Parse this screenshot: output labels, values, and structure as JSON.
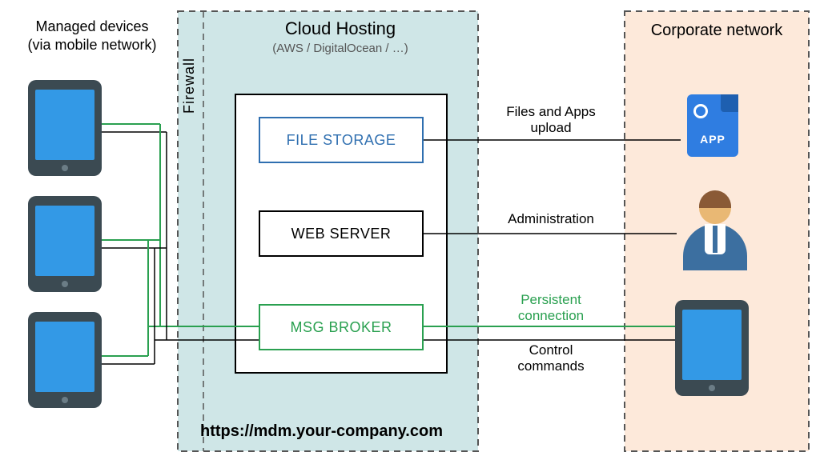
{
  "managed_devices": {
    "title": "Managed devices\n(via mobile network)"
  },
  "firewall_label": "Firewall",
  "cloud_hosting": {
    "title": "Cloud Hosting",
    "subtitle": "(AWS / DigitalOcean / …)",
    "services": {
      "storage": "FILE STORAGE",
      "web": "WEB SERVER",
      "broker": "MSG BROKER"
    },
    "url": "https://mdm.your-company.com"
  },
  "corporate": {
    "title": "Corporate network",
    "app_label": "APP"
  },
  "edges": {
    "files_apps": "Files and Apps\nupload",
    "administration": "Administration",
    "persistent": "Persistent\nconnection",
    "control": "Control\ncommands"
  },
  "colors": {
    "device_body": "#3b4a52",
    "device_screen": "#3399e6",
    "firewall_bg": "#cfe6e7",
    "corporate_bg": "#fde9da",
    "storage": "#2f6fb0",
    "broker": "#2aa050",
    "app": "#2f7de1"
  }
}
